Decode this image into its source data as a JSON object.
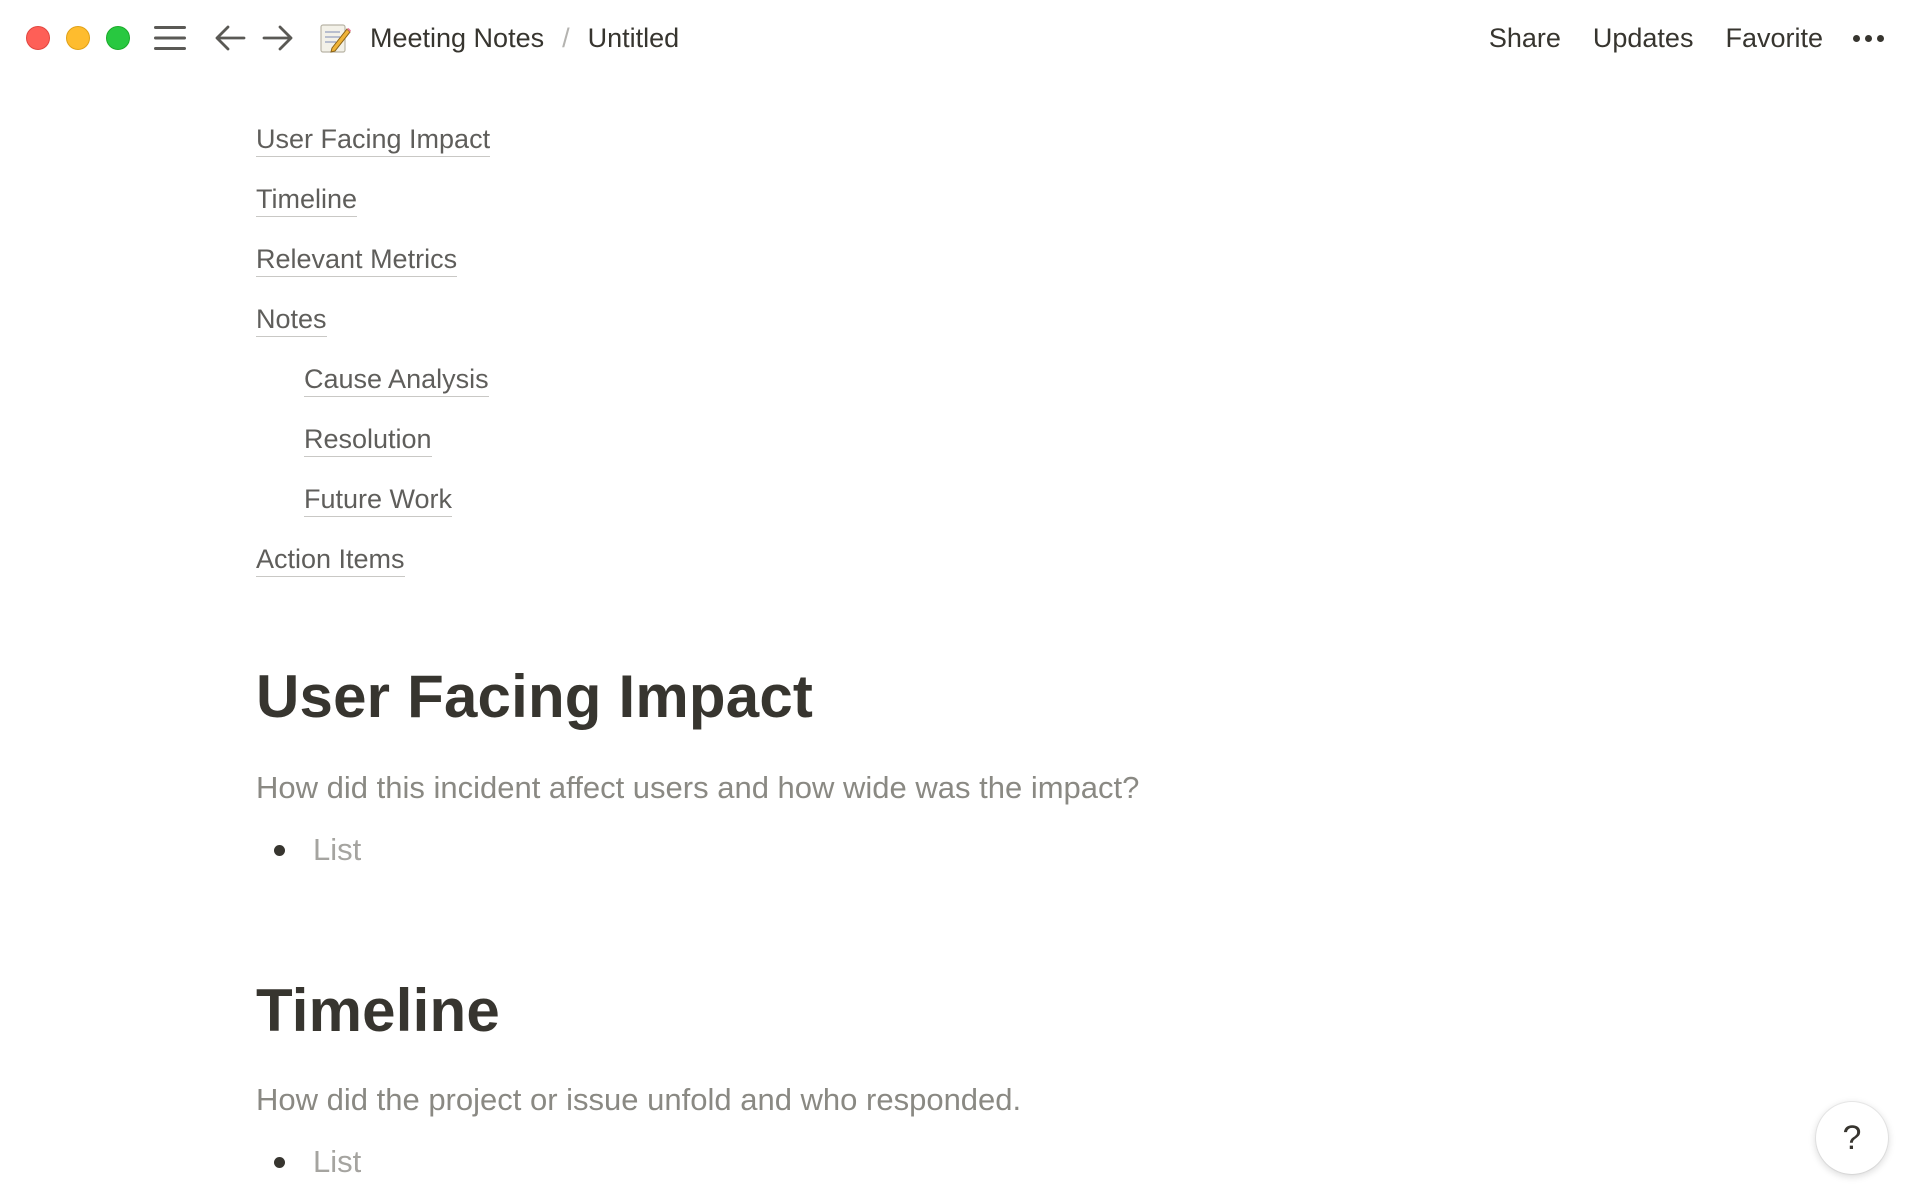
{
  "titlebar": {
    "breadcrumb": {
      "parent": "Meeting Notes",
      "separator": "/",
      "current": "Untitled",
      "page_icon": "memo-icon"
    },
    "actions": {
      "share": "Share",
      "updates": "Updates",
      "favorite": "Favorite",
      "more_icon": "more-icon"
    }
  },
  "toc": {
    "items": [
      {
        "label": "User Facing Impact",
        "indent": 0
      },
      {
        "label": "Timeline",
        "indent": 0
      },
      {
        "label": "Relevant Metrics",
        "indent": 0
      },
      {
        "label": "Notes",
        "indent": 0
      },
      {
        "label": "Cause Analysis",
        "indent": 1
      },
      {
        "label": "Resolution",
        "indent": 1
      },
      {
        "label": "Future Work",
        "indent": 1
      },
      {
        "label": "Action Items",
        "indent": 0
      }
    ]
  },
  "sections": [
    {
      "heading": "User Facing Impact",
      "description": "How did this incident affect users and how wide was the impact?",
      "bullet": "List"
    },
    {
      "heading": "Timeline",
      "description": "How did the project or issue unfold and who responded.",
      "bullet": "List"
    }
  ],
  "help": {
    "label": "?"
  },
  "colors": {
    "text": "#37352f",
    "muted": "#8a8983",
    "placeholder": "#a5a4a0",
    "close": "#fe5f57",
    "minimize": "#febc2e",
    "zoom": "#28c840"
  }
}
